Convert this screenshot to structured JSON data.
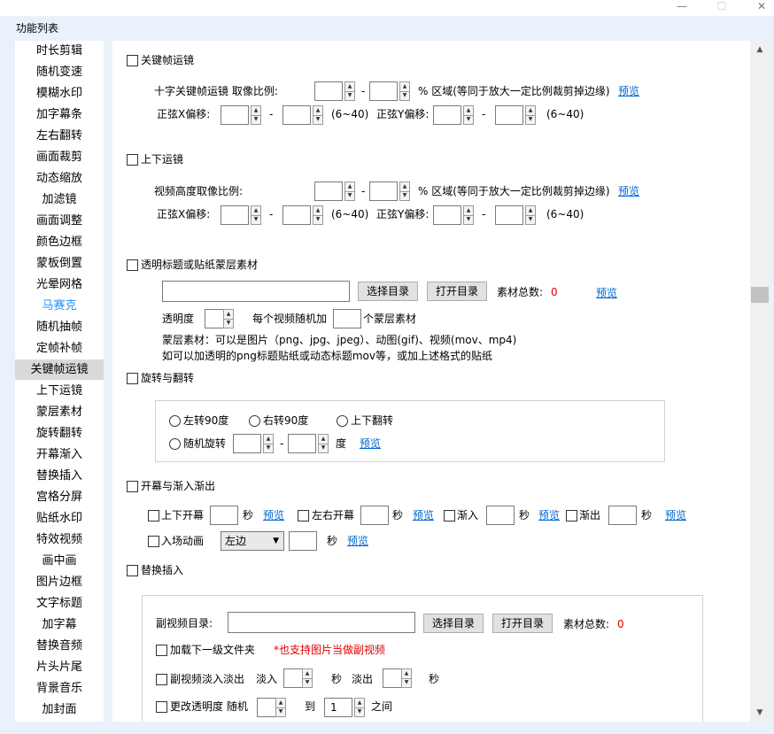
{
  "window": {
    "minimize": "—",
    "maximize": "☐",
    "close": "✕"
  },
  "panel_title": "功能列表",
  "sidebar": {
    "items": [
      {
        "label": "时长剪辑"
      },
      {
        "label": "随机变速"
      },
      {
        "label": "模糊水印"
      },
      {
        "label": "加字幕条"
      },
      {
        "label": "左右翻转"
      },
      {
        "label": "画面裁剪"
      },
      {
        "label": "动态缩放"
      },
      {
        "label": "加滤镜"
      },
      {
        "label": "画面调整"
      },
      {
        "label": "颜色边框"
      },
      {
        "label": "蒙板倒置"
      },
      {
        "label": "光晕网格"
      },
      {
        "label": "马赛克"
      },
      {
        "label": "随机抽帧"
      },
      {
        "label": "定帧补帧"
      },
      {
        "label": "关键帧运镜"
      },
      {
        "label": "上下运镜"
      },
      {
        "label": "蒙层素材"
      },
      {
        "label": "旋转翻转"
      },
      {
        "label": "开幕渐入"
      },
      {
        "label": "替换插入"
      },
      {
        "label": "宫格分屏"
      },
      {
        "label": "贴纸水印"
      },
      {
        "label": "特效视频"
      },
      {
        "label": "画中画"
      },
      {
        "label": "图片边框"
      },
      {
        "label": "文字标题"
      },
      {
        "label": "加字幕"
      },
      {
        "label": "替换音频"
      },
      {
        "label": "片头片尾"
      },
      {
        "label": "背景音乐"
      },
      {
        "label": "加封面"
      }
    ],
    "selected": "关键帧运镜",
    "highlight": "马赛克"
  },
  "s1": {
    "title": "关键帧运镜",
    "row1_label": "十字关键帧运镜  取像比例:",
    "dash": "-",
    "pct_text": "% 区域(等同于放大一定比例裁剪掉边缘)",
    "preview": "预览",
    "x_label": "正弦X偏移:",
    "range": "(6~40)",
    "y_label": "正弦Y偏移:"
  },
  "s2": {
    "title": "上下运镜",
    "row1_label": "视频高度取像比例:",
    "pct_text": "% 区域(等同于放大一定比例裁剪掉边缘)",
    "preview": "预览",
    "x_label": "正弦X偏移:",
    "range": "(6~40)",
    "y_label": "正弦Y偏移:"
  },
  "s3": {
    "title": "透明标题或贴纸蒙层素材",
    "choose_dir": "选择目录",
    "open_dir": "打开目录",
    "count_label": "素材总数:",
    "count": "0",
    "preview": "预览",
    "opacity_label": "透明度",
    "each_label": "每个视频随机加",
    "layers_label": "个蒙层素材",
    "note1": "蒙层素材：可以是图片（png、jpg、jpeg）、动图(gif)、视频(mov、mp4)",
    "note2": "如可以加透明的png标题贴纸或动态标题mov等，或加上述格式的贴纸"
  },
  "s4": {
    "title": "旋转与翻转",
    "opt_left": "左转90度",
    "opt_right": "右转90度",
    "opt_flip": "上下翻转",
    "opt_random": "随机旋转",
    "degree": "度",
    "preview": "预览"
  },
  "s5": {
    "title": "开幕与渐入渐出",
    "open_ud": "上下开幕",
    "open_lr": "左右开幕",
    "fade_in": "渐入",
    "fade_out": "渐出",
    "sec": "秒",
    "preview": "预览",
    "enter_anim": "入场动画",
    "enter_dir": "左边"
  },
  "s6": {
    "title": "替换插入",
    "sub_dir_label": "副视频目录:",
    "choose_dir": "选择目录",
    "open_dir": "打开目录",
    "count_label": "素材总数:",
    "count": "0",
    "load_sub": "加载下一级文件夹",
    "img_note": "*也支持图片当做副视频",
    "sub_fade": "副视频淡入淡出",
    "fade_in": "淡入",
    "sec": "秒",
    "fade_out": "淡出",
    "change_opacity": "更改透明度 随机",
    "to": "到",
    "opacity_to": "1",
    "between": "之间"
  }
}
